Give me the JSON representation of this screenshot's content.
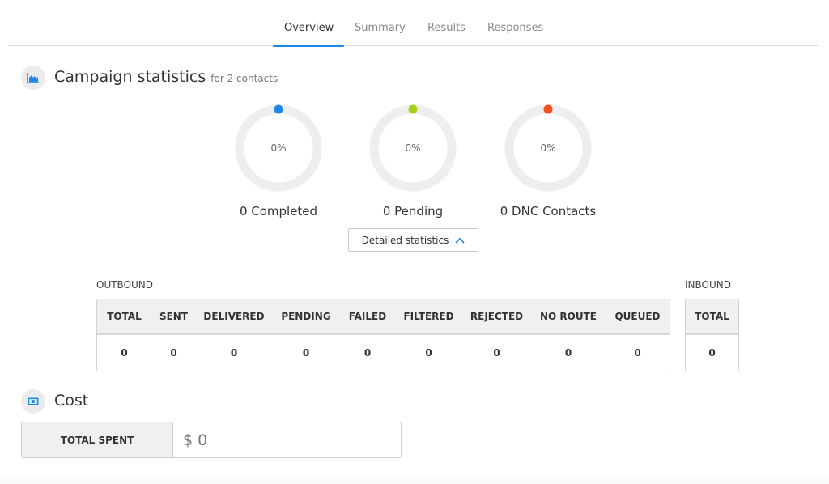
{
  "tabs": [
    {
      "label": "Overview",
      "active": true
    },
    {
      "label": "Summary",
      "active": false
    },
    {
      "label": "Results",
      "active": false
    },
    {
      "label": "Responses",
      "active": false
    }
  ],
  "campaign": {
    "icon": "area-chart-icon",
    "title": "Campaign statistics",
    "subtitle": "for 2 contacts",
    "donuts": [
      {
        "percent_label": "0%",
        "percent": 0,
        "label": "0 Completed",
        "color": "#1e88e5"
      },
      {
        "percent_label": "0%",
        "percent": 0,
        "label": "0 Pending",
        "color": "#a8d11a"
      },
      {
        "percent_label": "0%",
        "percent": 0,
        "label": "0 DNC Contacts",
        "color": "#f0501e"
      }
    ],
    "detail_button": {
      "label": "Detailed statistics",
      "icon": "chevron-up-icon"
    }
  },
  "outbound": {
    "label": "OUTBOUND",
    "headers": [
      "TOTAL",
      "SENT",
      "DELIVERED",
      "PENDING",
      "FAILED",
      "FILTERED",
      "REJECTED",
      "NO ROUTE",
      "QUEUED"
    ],
    "values": [
      "0",
      "0",
      "0",
      "0",
      "0",
      "0",
      "0",
      "0",
      "0"
    ]
  },
  "inbound": {
    "label": "INBOUND",
    "headers": [
      "TOTAL"
    ],
    "values": [
      "0"
    ]
  },
  "cost": {
    "icon": "money-bill-icon",
    "title": "Cost",
    "total_label": "TOTAL SPENT",
    "total_value": "$ 0"
  },
  "colors": {
    "accent": "#1e88e5",
    "ring_track": "#eeeeee"
  }
}
